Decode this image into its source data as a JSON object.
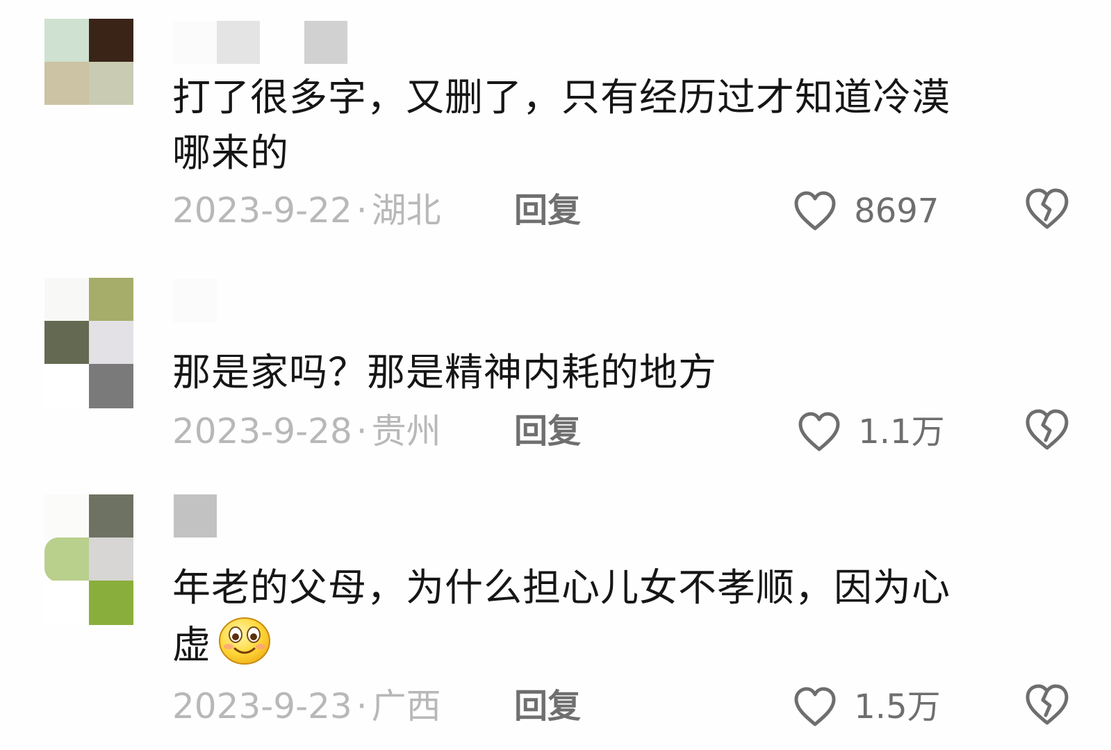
{
  "comments": [
    {
      "text_line1": "打了很多字，又删了，只有经历过才知道冷漠",
      "text_line2": "哪来的",
      "date": "2023-9-22",
      "location": "湖北",
      "reply_label": "回复",
      "likes": "8697",
      "avatar_colors": [
        "#cfe1d0",
        "#3a2418",
        "#cbc3a3",
        "#c9ccb3"
      ],
      "name_colors": [
        "#fbfbfb",
        "#e4e4e4",
        "#d1d1d1"
      ]
    },
    {
      "text_line1": "那是家吗？那是精神内耗的地方",
      "date": "2023-9-28",
      "location": "贵州",
      "reply_label": "回复",
      "likes": "1.1万",
      "avatar_colors": [
        "#f8f8f6",
        "#a6ac6a",
        "#646a52",
        "#e3e1e6",
        "#ffffff",
        "#7a7a7a"
      ],
      "name_colors": [
        "#fbfbfb"
      ]
    },
    {
      "text_line1": "年老的父母，为什么担心儿女不孝顺，因为心",
      "text_line2": "虚",
      "emoji": "smile-emoji",
      "date": "2023-9-23",
      "location": "广西",
      "reply_label": "回复",
      "likes": "1.5万",
      "avatar_colors": [
        "#fbfbf9",
        "#6e7263",
        "#b9cf8c",
        "#d7d6d4",
        "#ffffff",
        "#8aae3c"
      ],
      "name_colors": [
        "#c2c2c2"
      ]
    }
  ],
  "dot": "·",
  "icons": {
    "like": "heart-outline-icon",
    "dislike": "broken-heart-icon"
  }
}
